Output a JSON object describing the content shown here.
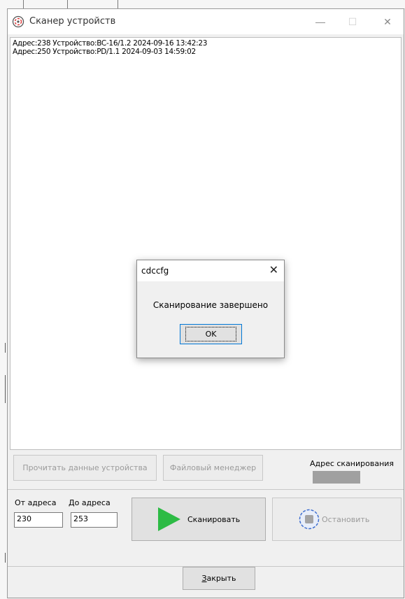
{
  "window": {
    "title": "Сканер устройств",
    "minimize_glyph": "—",
    "maximize_glyph": "☐",
    "close_glyph": "✕"
  },
  "log": {
    "lines": [
      "Адрес:238 Устройство:BC-16/1.2 2024-09-16 13:42:23",
      "Адрес:250 Устройство:PD/1.1 2024-09-03 14:59:02"
    ]
  },
  "actions": {
    "read_device_label": "Прочитать данные устройства",
    "file_manager_label": "Файловый менеджер",
    "scan_address_label": "Адрес сканирования"
  },
  "range": {
    "from_label": "От адреса",
    "to_label": "До адреса",
    "from_value": "230",
    "to_value": "253"
  },
  "scan": {
    "scan_label": "Сканировать",
    "stop_label": "Остановить",
    "play_color": "#2dbb45"
  },
  "footer": {
    "close_mnemonic": "З",
    "close_rest": "акрыть"
  },
  "dialog": {
    "title": "cdccfg",
    "message": "Сканирование завершено",
    "ok_label": "OK",
    "close_glyph": "✕"
  }
}
